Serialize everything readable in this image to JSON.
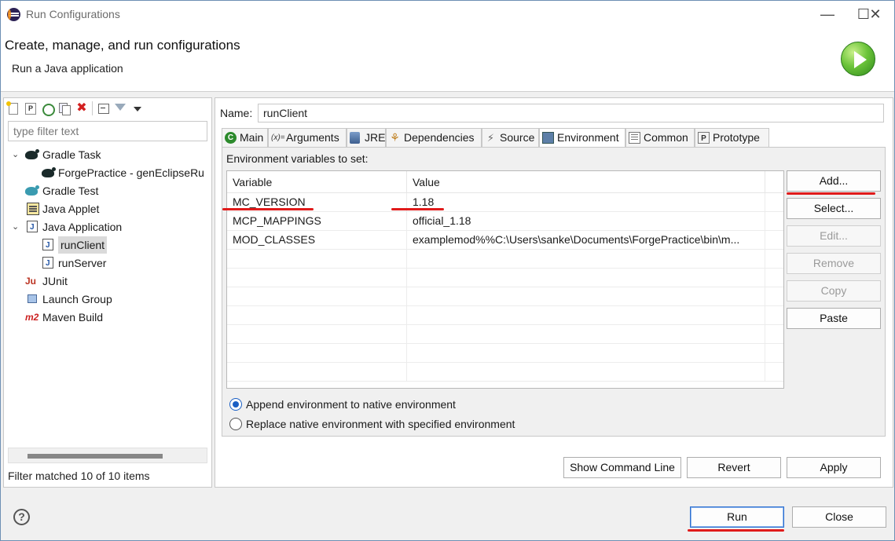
{
  "window": {
    "title": "Run Configurations",
    "min_glyph": "—",
    "max_glyph": "☐",
    "close_glyph": "✕"
  },
  "banner": {
    "heading": "Create, manage, and run configurations",
    "subheading": "Run a Java application",
    "icon": "run-icon"
  },
  "left": {
    "filter_placeholder": "type filter text",
    "tree": [
      {
        "label": "Gradle Task",
        "icon": "gradle-icon",
        "expanded": true
      },
      {
        "label": "ForgePractice - genEclipseRu",
        "icon": "gradle-icon"
      },
      {
        "label": "Gradle Test",
        "icon": "gradle-icon"
      },
      {
        "label": "Java Applet",
        "icon": "applet-icon"
      },
      {
        "label": "Java Application",
        "icon": "java-app-icon",
        "expanded": true
      },
      {
        "label": "runClient",
        "icon": "java-app-icon",
        "selected": true
      },
      {
        "label": "runServer",
        "icon": "java-app-icon"
      },
      {
        "label": "JUnit",
        "icon": "junit-icon",
        "glyph": "Ju"
      },
      {
        "label": "Launch Group",
        "icon": "launch-group-icon"
      },
      {
        "label": "Maven Build",
        "icon": "maven-icon",
        "glyph": "m2"
      }
    ],
    "status": "Filter matched 10 of 10 items"
  },
  "right": {
    "name_label": "Name:",
    "name_value": "runClient",
    "tabs": [
      {
        "label": "Main",
        "icon": "main-icon",
        "glyph": "C"
      },
      {
        "label": "Arguments",
        "icon": "arguments-icon",
        "glyph": "(x)="
      },
      {
        "label": "JRE",
        "icon": "jre-icon"
      },
      {
        "label": "Dependencies",
        "icon": "dependencies-icon",
        "glyph": "⚘"
      },
      {
        "label": "Source",
        "icon": "source-icon",
        "glyph": "⚡"
      },
      {
        "label": "Environment",
        "icon": "environment-icon",
        "active": true
      },
      {
        "label": "Common",
        "icon": "common-icon"
      },
      {
        "label": "Prototype",
        "icon": "prototype-icon",
        "glyph": "P"
      }
    ],
    "env": {
      "label": "Environment variables to set:",
      "columns": [
        "Variable",
        "Value"
      ],
      "rows": [
        {
          "variable": "MC_VERSION",
          "value": "1.18"
        },
        {
          "variable": "MCP_MAPPINGS",
          "value": "official_1.18"
        },
        {
          "variable": "MOD_CLASSES",
          "value": "examplemod%%C:\\Users\\sanke\\Documents\\ForgePractice\\bin\\m..."
        }
      ],
      "buttons": {
        "add": "Add...",
        "select": "Select...",
        "edit": "Edit...",
        "remove": "Remove",
        "copy": "Copy",
        "paste": "Paste"
      },
      "radio_append": "Append environment to native environment",
      "radio_replace": "Replace native environment with specified environment",
      "selected_mode": "append"
    },
    "buttons": {
      "show_command_line": "Show Command Line",
      "revert": "Revert",
      "apply": "Apply"
    }
  },
  "footer": {
    "help_glyph": "?",
    "run": "Run",
    "close": "Close"
  },
  "colors": {
    "annotation_red": "#e01b1b",
    "accent_blue": "#1a5fc4"
  }
}
